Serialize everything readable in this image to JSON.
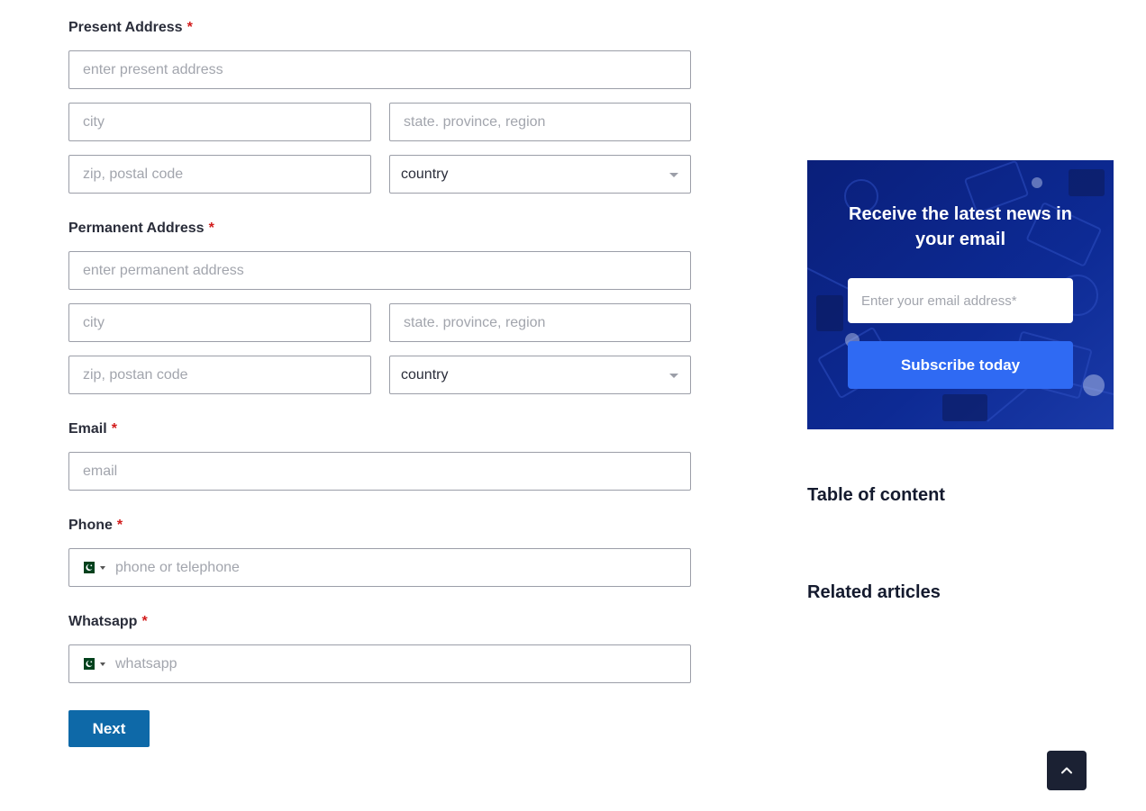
{
  "form": {
    "required_mark": "*",
    "present": {
      "label": "Present Address",
      "address_placeholder": "enter present address",
      "city_placeholder": "city",
      "state_placeholder": "state. province, region",
      "zip_placeholder": "zip, postal code",
      "country_value": "country"
    },
    "permanent": {
      "label": "Permanent Address",
      "address_placeholder": "enter permanent address",
      "city_placeholder": "city",
      "state_placeholder": "state. province, region",
      "zip_placeholder": "zip, postan code",
      "country_value": "country"
    },
    "email": {
      "label": "Email",
      "placeholder": "email"
    },
    "phone": {
      "label": "Phone",
      "placeholder": "phone or telephone",
      "flag_icon": "pakistan-flag-icon"
    },
    "whatsapp": {
      "label": "Whatsapp",
      "placeholder": "whatsapp",
      "flag_icon": "pakistan-flag-icon"
    },
    "next_label": "Next"
  },
  "sidebar": {
    "newsletter": {
      "title": "Receive the latest news in your email",
      "email_placeholder": "Enter your email address*",
      "subscribe_label": "Subscribe today"
    },
    "toc_heading": "Table of content",
    "related_heading": "Related articles"
  },
  "scroll_top_icon": "chevron-up-icon",
  "colors": {
    "accent_blue": "#0e69a8",
    "subscribe_blue": "#2f6af3",
    "required_red": "#d21c1c",
    "dark": "#1b2133"
  }
}
